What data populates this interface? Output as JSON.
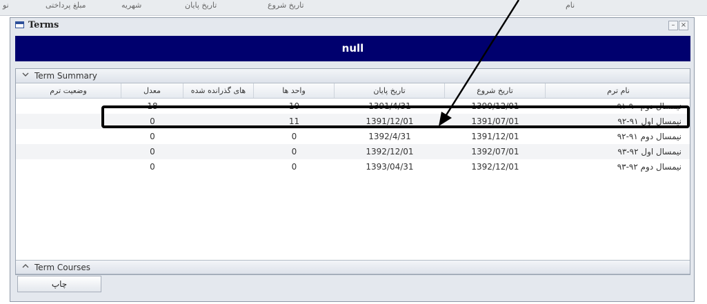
{
  "background_header": {
    "cells": [
      "نو",
      "مبلغ پرداختی",
      "شهریه",
      "تاریخ پایان",
      "تاریخ شروع",
      "نام"
    ]
  },
  "window": {
    "title": "Terms",
    "minimize_label": "–",
    "close_label": "×"
  },
  "banner": {
    "text": "null"
  },
  "term_summary": {
    "label": "Term Summary",
    "columns": [
      "نام ترم",
      "تاریخ شروع",
      "تاریخ پایان",
      "واحد ها",
      "های گذرانده شده",
      "معدل",
      "وضعیت ترم"
    ],
    "rows": [
      {
        "name": "نیمسال دوم ۹۰-۹۱",
        "start": "1390/12/01",
        "end": "1391/4/31",
        "units": "10",
        "passed": "",
        "gpa": "18",
        "status": ""
      },
      {
        "name": "نیمسال اول ۹۱-۹۲",
        "start": "1391/07/01",
        "end": "1391/12/01",
        "units": "11",
        "passed": "",
        "gpa": "0",
        "status": ""
      },
      {
        "name": "نیمسال دوم ۹۱-۹۲",
        "start": "1391/12/01",
        "end": "1392/4/31",
        "units": "0",
        "passed": "",
        "gpa": "0",
        "status": ""
      },
      {
        "name": "نیمسال اول ۹۲-۹۳",
        "start": "1392/07/01",
        "end": "1392/12/01",
        "units": "0",
        "passed": "",
        "gpa": "0",
        "status": ""
      },
      {
        "name": "نیمسال دوم ۹۲-۹۳",
        "start": "1392/12/01",
        "end": "1393/04/31",
        "units": "0",
        "passed": "",
        "gpa": "0",
        "status": ""
      }
    ]
  },
  "term_courses": {
    "label": "Term Courses"
  },
  "print_button": {
    "label": "چاپ"
  },
  "icons": {
    "collapse": "chevron-down-icon",
    "expand": "chevron-up-icon"
  },
  "colors": {
    "banner": "#00006e",
    "window_bg": "#e4e8ee"
  }
}
